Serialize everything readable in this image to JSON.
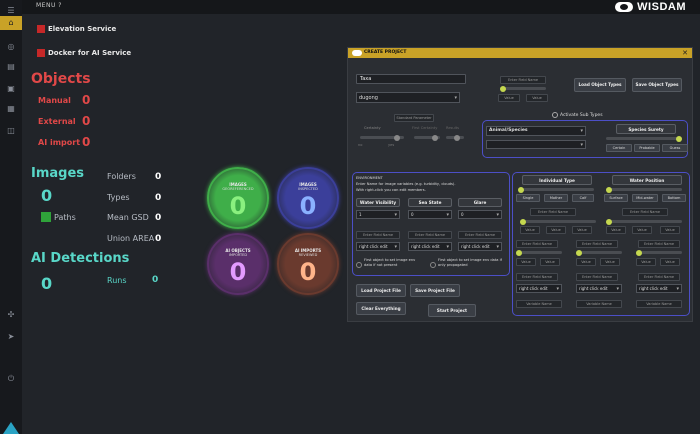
{
  "topbar": {
    "menu_label": "MENU ?",
    "logo_text": "WISDAM"
  },
  "sidebar": {
    "icons": [
      "menu-icon",
      "home-icon",
      "globe-icon",
      "book-icon",
      "image-icon",
      "grid-icon",
      "database-icon",
      "tool-icon",
      "plug-icon",
      "exit-icon"
    ]
  },
  "services": {
    "elevation": "Elevation Service",
    "docker": "Docker for AI Service"
  },
  "objects": {
    "title": "Objects",
    "rows": [
      {
        "label": "Manual",
        "value": "0"
      },
      {
        "label": "External",
        "value": "0"
      },
      {
        "label": "AI import",
        "value": "0"
      }
    ]
  },
  "images": {
    "title": "Images",
    "count": "0",
    "paths_label": "Paths",
    "stats": [
      {
        "label": "Folders",
        "value": "0"
      },
      {
        "label": "Types",
        "value": "0"
      },
      {
        "label": "Mean GSD",
        "value": "0"
      },
      {
        "label": "Union AREA",
        "value": "0"
      }
    ]
  },
  "ai_detections": {
    "title": "AI  Detections",
    "count": "0",
    "runs_label": "Runs",
    "runs_value": "0"
  },
  "circles": [
    {
      "line1": "IMAGES",
      "line2": "GEOREFERENCED",
      "value": "0",
      "color": "#3fae49",
      "text": "#8af07f"
    },
    {
      "line1": "IMAGES",
      "line2": "INSPECTED",
      "value": "0",
      "color": "#3b3f9a",
      "text": "#8ab1ff"
    },
    {
      "line1": "AI OBJECTS",
      "line2": "IMPORTED",
      "value": "0",
      "color": "#5a2f6a",
      "text": "#e39bff"
    },
    {
      "line1": "AI IMPORTS",
      "line2": "REVIEWED",
      "value": "0",
      "color": "#6a3a2e",
      "text": "#ffb48a"
    }
  ],
  "dialog": {
    "title": "CREATE PROJECT",
    "taxa_value": "Taxa",
    "species_value": "dugong",
    "enter_field_name": "Enter Field Name",
    "value_label": "Value",
    "load_object_types": "Load Object Types",
    "save_object_types": "Save Object Types",
    "standard_parameter": "Standard Parameter",
    "activate_subtypes": "Activate Sub Types",
    "certainty": "Certainty",
    "first_certainty": "First Certainty",
    "results": "Results",
    "no": "no",
    "yes": "yes",
    "animal_species": "Animal/Species",
    "species_surety": "Species Surety",
    "certain": "Certain",
    "probable": "Probable",
    "guess": "Guess",
    "env_title": "ENVIRONMENT",
    "env_desc1": "Enter Name for image variables (e.g. turbidity, clouds).",
    "env_desc2": "With right-click you can edit members.",
    "water_visibility": "Water Visibility",
    "sea_state": "Sea State",
    "glare": "Glare",
    "sel_1": "1",
    "sel_0a": "0",
    "sel_0b": "0",
    "right_click_edit": "right click edit",
    "first_obj_not_present": "First object to set image env data if not present",
    "first_obj_only_propagated": "First object to set image env data if only propagated",
    "load_project_file": "Load Project File",
    "save_project_file": "Save Project File",
    "clear_everything": "Clear Everything",
    "start_project": "Start Project",
    "individual_type": "Individual Type",
    "water_position": "Water Position",
    "single": "Single",
    "mother": "Mother",
    "calf": "Calf",
    "surface": "Surface",
    "mid_water": "Mid-water",
    "bottom": "Bottom",
    "variable_name": "Variable Name"
  }
}
